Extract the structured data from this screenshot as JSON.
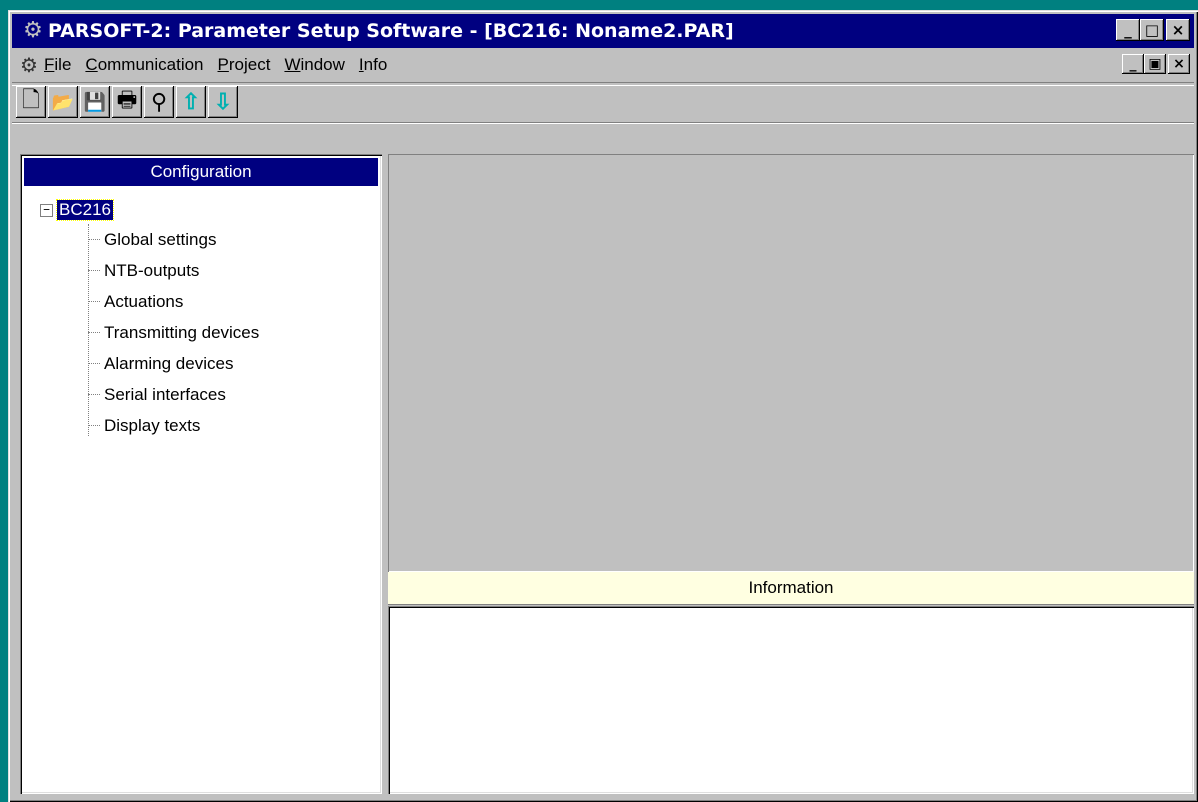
{
  "window": {
    "title": "PARSOFT-2: Parameter Setup Software - [BC216: Noname2.PAR]",
    "controls": {
      "minimize": "_",
      "maximize": "□",
      "close": "×"
    },
    "mdi_controls": {
      "minimize": "_",
      "restore": "▣",
      "close": "×"
    }
  },
  "menu": {
    "items": [
      {
        "label": "File",
        "accel": "F",
        "rest": "ile"
      },
      {
        "label": "Communication",
        "accel": "C",
        "rest": "ommunication"
      },
      {
        "label": "Project",
        "accel": "P",
        "rest": "roject"
      },
      {
        "label": "Window",
        "accel": "W",
        "rest": "indow"
      },
      {
        "label": "Info",
        "accel": "I",
        "rest": "nfo"
      }
    ]
  },
  "toolbar": {
    "buttons": [
      {
        "icon": "new-document-icon",
        "glyph": "🗋"
      },
      {
        "icon": "open-folder-icon",
        "glyph": "📂"
      },
      {
        "icon": "save-icon",
        "glyph": "💾"
      },
      {
        "icon": "print-icon",
        "glyph": "🖶"
      },
      {
        "icon": "preview-magnifier-icon",
        "glyph": "⚲"
      },
      {
        "icon": "upload-arrow-icon",
        "glyph": "⇧"
      },
      {
        "icon": "download-arrow-icon",
        "glyph": "⇩"
      }
    ]
  },
  "configuration": {
    "header": "Configuration",
    "root": {
      "label": "BC216",
      "expander": "−"
    },
    "children": [
      "Global settings",
      "NTB-outputs",
      "Actuations",
      "Transmitting devices",
      "Alarming devices",
      "Serial interfaces",
      "Display texts"
    ]
  },
  "information": {
    "header": "Information"
  },
  "colors": {
    "titlebar": "#000080",
    "desktop": "#008080",
    "face": "#c0c0c0",
    "info_header": "#ffffe1"
  }
}
